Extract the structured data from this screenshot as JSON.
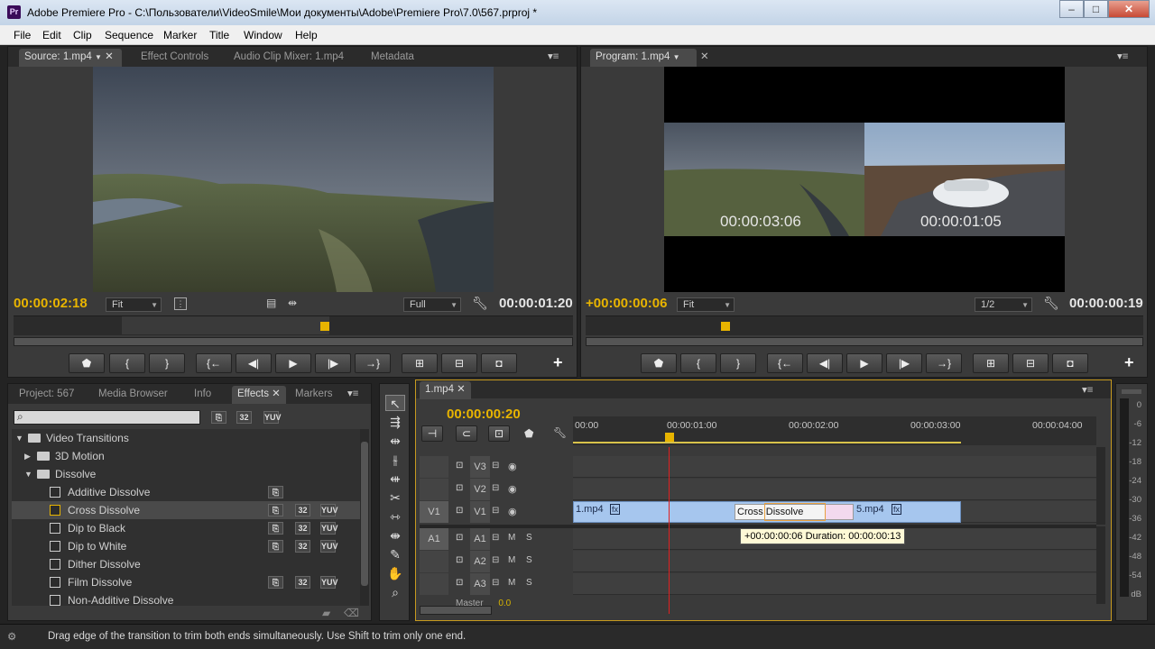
{
  "window": {
    "app_icon": "Pr",
    "title": "Adobe Premiere Pro - C:\\Пользователи\\VideoSmile\\Мои документы\\Adobe\\Premiere Pro\\7.0\\567.prproj *",
    "controls": [
      "minimize-icon",
      "maximize-icon",
      "close-icon"
    ]
  },
  "menu": [
    "File",
    "Edit",
    "Clip",
    "Sequence",
    "Marker",
    "Title",
    "Window",
    "Help"
  ],
  "source_monitor": {
    "tabs": [
      "Source: 1.mp4",
      "Effect Controls",
      "Audio Clip Mixer: 1.mp4",
      "Metadata"
    ],
    "timecode": "00:00:02:18",
    "fit": "Fit",
    "resolution": "Full",
    "duration": "00:00:01:20",
    "transport": [
      "marker-icon",
      "mark-in-icon",
      "mark-out-icon",
      "go-to-in-icon",
      "step-back-icon",
      "play-icon",
      "step-forward-icon",
      "go-to-out-icon",
      "insert-icon",
      "overwrite-icon",
      "export-frame-icon",
      "add-icon"
    ]
  },
  "program_monitor": {
    "tabs": [
      "Program: 1.mp4"
    ],
    "timecode": "+00:00:00:06",
    "fit": "Fit",
    "resolution": "1/2",
    "duration": "00:00:00:19",
    "overlay_left_tc": "00:00:03:06",
    "overlay_right_tc": "00:00:01:05",
    "transport": [
      "marker-icon",
      "mark-in-icon",
      "mark-out-icon",
      "go-to-in-icon",
      "step-back-icon",
      "play-icon",
      "step-forward-icon",
      "go-to-out-icon",
      "lift-icon",
      "extract-icon",
      "export-frame-icon",
      "add-icon"
    ]
  },
  "project_panel": {
    "tabs": [
      "Project: 567",
      "Media Browser",
      "Info",
      "Effects",
      "Markers"
    ],
    "search_value": "",
    "badges": [
      "32",
      "YUV"
    ],
    "tree": [
      {
        "label": "Video Transitions",
        "level": 0,
        "type": "folder",
        "expanded": true
      },
      {
        "label": "3D Motion",
        "level": 1,
        "type": "folder",
        "expanded": false
      },
      {
        "label": "Dissolve",
        "level": 1,
        "type": "folder",
        "expanded": true
      },
      {
        "label": "Additive Dissolve",
        "level": 2,
        "type": "effect",
        "badges": [
          "acc"
        ]
      },
      {
        "label": "Cross Dissolve",
        "level": 2,
        "type": "effect",
        "badges": [
          "acc",
          "32",
          "YUV"
        ],
        "selected": true
      },
      {
        "label": "Dip to Black",
        "level": 2,
        "type": "effect",
        "badges": [
          "acc",
          "32",
          "YUV"
        ]
      },
      {
        "label": "Dip to White",
        "level": 2,
        "type": "effect",
        "badges": [
          "acc",
          "32",
          "YUV"
        ]
      },
      {
        "label": "Dither Dissolve",
        "level": 2,
        "type": "effect",
        "badges": []
      },
      {
        "label": "Film Dissolve",
        "level": 2,
        "type": "effect",
        "badges": [
          "acc",
          "32",
          "YUV"
        ]
      },
      {
        "label": "Non-Additive Dissolve",
        "level": 2,
        "type": "effect",
        "badges": []
      }
    ]
  },
  "tools": [
    "selection-tool-icon",
    "track-select-tool-icon",
    "ripple-edit-tool-icon",
    "rolling-edit-tool-icon",
    "rate-stretch-tool-icon",
    "razor-tool-icon",
    "slip-tool-icon",
    "slide-tool-icon",
    "pen-tool-icon",
    "hand-tool-icon",
    "zoom-tool-icon"
  ],
  "timeline": {
    "tab": "1.mp4",
    "timecode": "00:00:00:20",
    "ruler": [
      "00:00",
      "00:00:01:00",
      "00:00:02:00",
      "00:00:03:00",
      "00:00:04:00"
    ],
    "video_tracks": [
      {
        "name": "V3",
        "source": ""
      },
      {
        "name": "V2",
        "source": ""
      },
      {
        "name": "V1",
        "source": "V1"
      }
    ],
    "audio_tracks": [
      {
        "name": "A1",
        "source": "A1"
      },
      {
        "name": "A2",
        "source": ""
      },
      {
        "name": "A3",
        "source": ""
      }
    ],
    "track_toggles": {
      "mute": "M",
      "solo": "S"
    },
    "master_label": "Master",
    "master_value": "0.0",
    "clips": [
      {
        "name": "1.mp4",
        "fx": "fx"
      },
      {
        "name": "5.mp4",
        "fx": "fx"
      }
    ],
    "transition_label": "Cross Dissolve",
    "tooltip": "+00:00:00:06 Duration: 00:00:00:13"
  },
  "audio_meter": {
    "labels": [
      "0",
      "-6",
      "-12",
      "-18",
      "-24",
      "-30",
      "-36",
      "-42",
      "-48",
      "-54",
      "dB"
    ]
  },
  "status": {
    "text": "Drag edge of the transition to trim both ends simultaneously. Use Shift to trim only one end."
  }
}
